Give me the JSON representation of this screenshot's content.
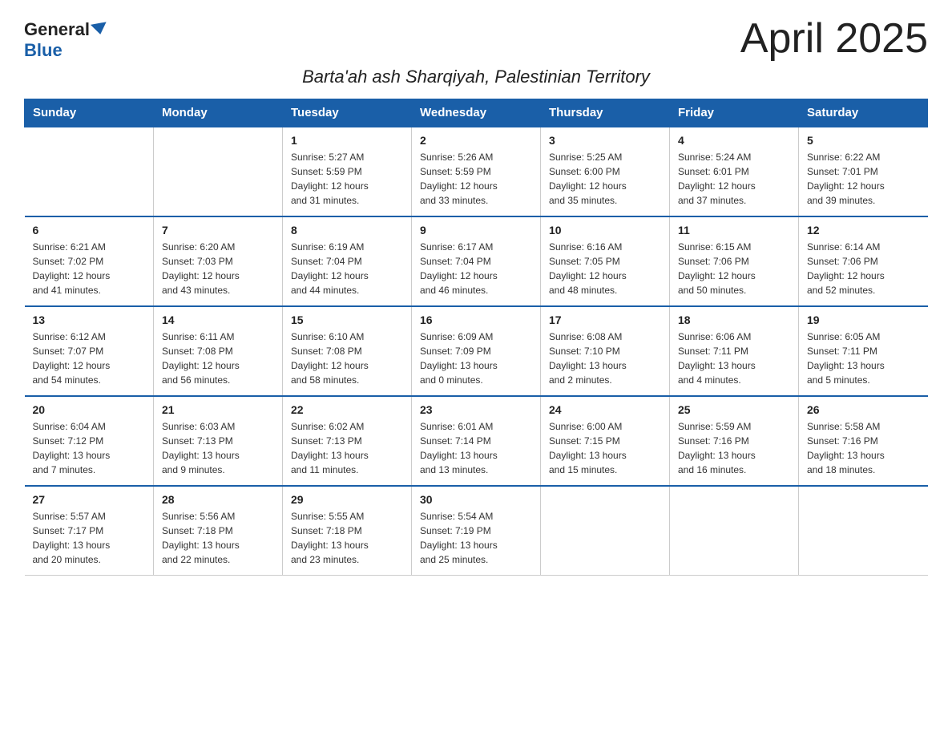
{
  "logo": {
    "general": "General",
    "blue": "Blue"
  },
  "title": "April 2025",
  "subtitle": "Barta'ah ash Sharqiyah, Palestinian Territory",
  "weekdays": [
    "Sunday",
    "Monday",
    "Tuesday",
    "Wednesday",
    "Thursday",
    "Friday",
    "Saturday"
  ],
  "weeks": [
    [
      {
        "day": "",
        "info": ""
      },
      {
        "day": "",
        "info": ""
      },
      {
        "day": "1",
        "info": "Sunrise: 5:27 AM\nSunset: 5:59 PM\nDaylight: 12 hours\nand 31 minutes."
      },
      {
        "day": "2",
        "info": "Sunrise: 5:26 AM\nSunset: 5:59 PM\nDaylight: 12 hours\nand 33 minutes."
      },
      {
        "day": "3",
        "info": "Sunrise: 5:25 AM\nSunset: 6:00 PM\nDaylight: 12 hours\nand 35 minutes."
      },
      {
        "day": "4",
        "info": "Sunrise: 5:24 AM\nSunset: 6:01 PM\nDaylight: 12 hours\nand 37 minutes."
      },
      {
        "day": "5",
        "info": "Sunrise: 6:22 AM\nSunset: 7:01 PM\nDaylight: 12 hours\nand 39 minutes."
      }
    ],
    [
      {
        "day": "6",
        "info": "Sunrise: 6:21 AM\nSunset: 7:02 PM\nDaylight: 12 hours\nand 41 minutes."
      },
      {
        "day": "7",
        "info": "Sunrise: 6:20 AM\nSunset: 7:03 PM\nDaylight: 12 hours\nand 43 minutes."
      },
      {
        "day": "8",
        "info": "Sunrise: 6:19 AM\nSunset: 7:04 PM\nDaylight: 12 hours\nand 44 minutes."
      },
      {
        "day": "9",
        "info": "Sunrise: 6:17 AM\nSunset: 7:04 PM\nDaylight: 12 hours\nand 46 minutes."
      },
      {
        "day": "10",
        "info": "Sunrise: 6:16 AM\nSunset: 7:05 PM\nDaylight: 12 hours\nand 48 minutes."
      },
      {
        "day": "11",
        "info": "Sunrise: 6:15 AM\nSunset: 7:06 PM\nDaylight: 12 hours\nand 50 minutes."
      },
      {
        "day": "12",
        "info": "Sunrise: 6:14 AM\nSunset: 7:06 PM\nDaylight: 12 hours\nand 52 minutes."
      }
    ],
    [
      {
        "day": "13",
        "info": "Sunrise: 6:12 AM\nSunset: 7:07 PM\nDaylight: 12 hours\nand 54 minutes."
      },
      {
        "day": "14",
        "info": "Sunrise: 6:11 AM\nSunset: 7:08 PM\nDaylight: 12 hours\nand 56 minutes."
      },
      {
        "day": "15",
        "info": "Sunrise: 6:10 AM\nSunset: 7:08 PM\nDaylight: 12 hours\nand 58 minutes."
      },
      {
        "day": "16",
        "info": "Sunrise: 6:09 AM\nSunset: 7:09 PM\nDaylight: 13 hours\nand 0 minutes."
      },
      {
        "day": "17",
        "info": "Sunrise: 6:08 AM\nSunset: 7:10 PM\nDaylight: 13 hours\nand 2 minutes."
      },
      {
        "day": "18",
        "info": "Sunrise: 6:06 AM\nSunset: 7:11 PM\nDaylight: 13 hours\nand 4 minutes."
      },
      {
        "day": "19",
        "info": "Sunrise: 6:05 AM\nSunset: 7:11 PM\nDaylight: 13 hours\nand 5 minutes."
      }
    ],
    [
      {
        "day": "20",
        "info": "Sunrise: 6:04 AM\nSunset: 7:12 PM\nDaylight: 13 hours\nand 7 minutes."
      },
      {
        "day": "21",
        "info": "Sunrise: 6:03 AM\nSunset: 7:13 PM\nDaylight: 13 hours\nand 9 minutes."
      },
      {
        "day": "22",
        "info": "Sunrise: 6:02 AM\nSunset: 7:13 PM\nDaylight: 13 hours\nand 11 minutes."
      },
      {
        "day": "23",
        "info": "Sunrise: 6:01 AM\nSunset: 7:14 PM\nDaylight: 13 hours\nand 13 minutes."
      },
      {
        "day": "24",
        "info": "Sunrise: 6:00 AM\nSunset: 7:15 PM\nDaylight: 13 hours\nand 15 minutes."
      },
      {
        "day": "25",
        "info": "Sunrise: 5:59 AM\nSunset: 7:16 PM\nDaylight: 13 hours\nand 16 minutes."
      },
      {
        "day": "26",
        "info": "Sunrise: 5:58 AM\nSunset: 7:16 PM\nDaylight: 13 hours\nand 18 minutes."
      }
    ],
    [
      {
        "day": "27",
        "info": "Sunrise: 5:57 AM\nSunset: 7:17 PM\nDaylight: 13 hours\nand 20 minutes."
      },
      {
        "day": "28",
        "info": "Sunrise: 5:56 AM\nSunset: 7:18 PM\nDaylight: 13 hours\nand 22 minutes."
      },
      {
        "day": "29",
        "info": "Sunrise: 5:55 AM\nSunset: 7:18 PM\nDaylight: 13 hours\nand 23 minutes."
      },
      {
        "day": "30",
        "info": "Sunrise: 5:54 AM\nSunset: 7:19 PM\nDaylight: 13 hours\nand 25 minutes."
      },
      {
        "day": "",
        "info": ""
      },
      {
        "day": "",
        "info": ""
      },
      {
        "day": "",
        "info": ""
      }
    ]
  ]
}
